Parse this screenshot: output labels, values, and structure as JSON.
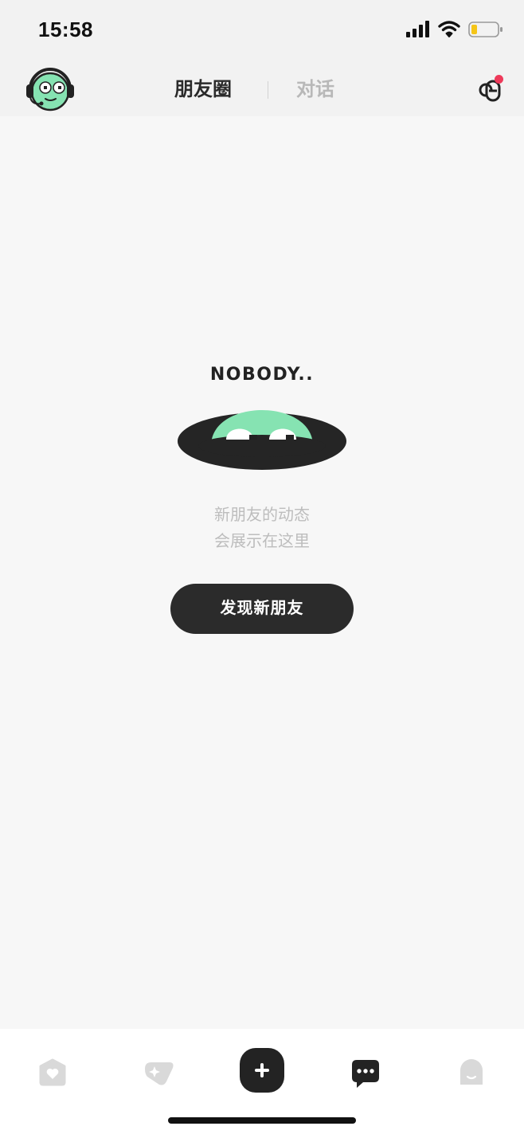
{
  "status_bar": {
    "time": "15:58",
    "icons": [
      "signal-icon",
      "wifi-icon",
      "battery-icon"
    ],
    "battery_color": "#f5c518"
  },
  "top_nav": {
    "tabs": [
      {
        "label": "朋友圈",
        "active": true
      },
      {
        "label": "对话",
        "active": false
      }
    ],
    "friends_icon": "friends-icon",
    "notification_dot_color": "#ee3a5a"
  },
  "empty_state": {
    "title": "NOBODY..",
    "line1": "新朋友的动态",
    "line2": "会展示在这里",
    "button_label": "发现新朋友",
    "accent_color": "#86e3b2"
  },
  "tab_bar": {
    "items": [
      {
        "icon": "heart-home-icon"
      },
      {
        "icon": "sparkle-tag-icon"
      },
      {
        "icon": "plus-icon"
      },
      {
        "icon": "chat-icon"
      },
      {
        "icon": "profile-icon"
      }
    ]
  }
}
